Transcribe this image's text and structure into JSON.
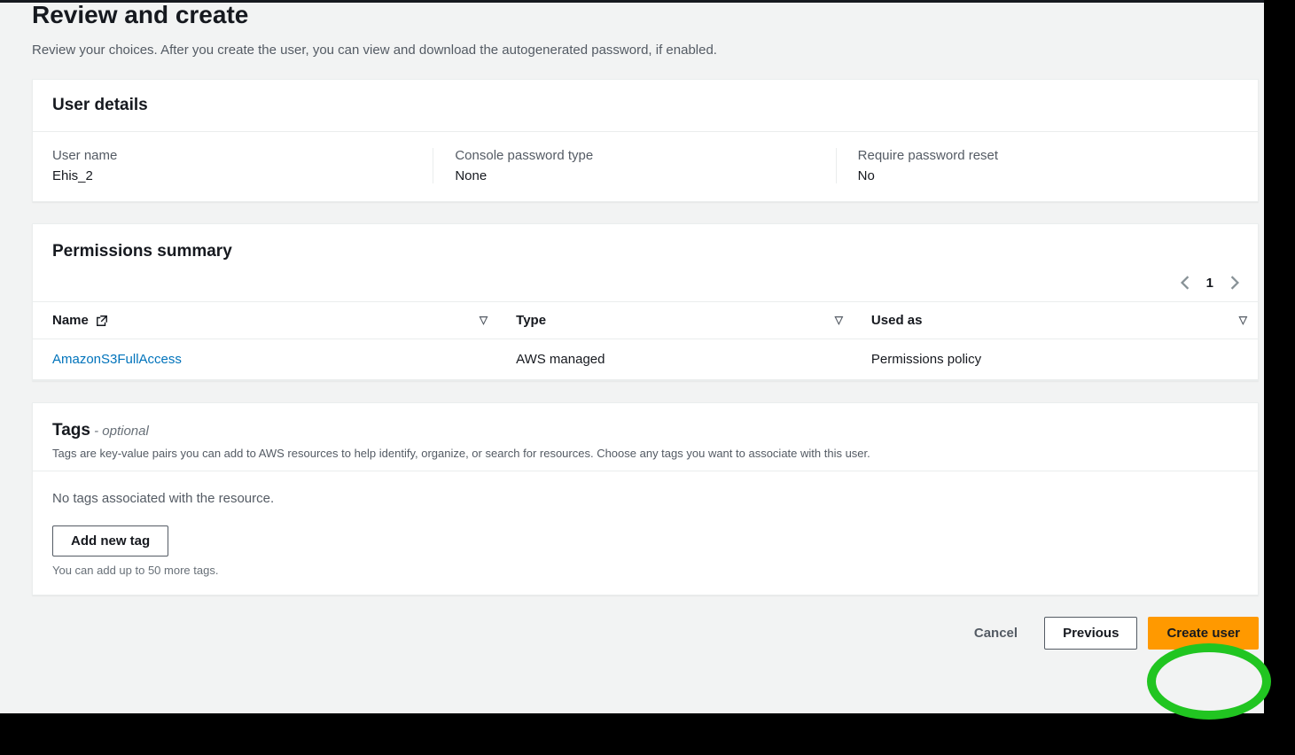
{
  "page": {
    "title": "Review and create",
    "subtitle": "Review your choices. After you create the user, you can view and download the autogenerated password, if enabled."
  },
  "userDetails": {
    "heading": "User details",
    "fields": {
      "userNameLabel": "User name",
      "userNameValue": "Ehis_2",
      "passwordTypeLabel": "Console password type",
      "passwordTypeValue": "None",
      "requireResetLabel": "Require password reset",
      "requireResetValue": "No"
    }
  },
  "permissions": {
    "heading": "Permissions summary",
    "pagination": {
      "current": "1"
    },
    "columns": {
      "name": "Name",
      "type": "Type",
      "usedAs": "Used as"
    },
    "rows": [
      {
        "name": "AmazonS3FullAccess",
        "type": "AWS managed",
        "usedAs": "Permissions policy"
      }
    ]
  },
  "tags": {
    "heading": "Tags",
    "optional": " - optional",
    "description": "Tags are key-value pairs you can add to AWS resources to help identify, organize, or search for resources. Choose any tags you want to associate with this user.",
    "emptyMsg": "No tags associated with the resource.",
    "addBtn": "Add new tag",
    "limitHint": "You can add up to 50 more tags."
  },
  "actions": {
    "cancel": "Cancel",
    "previous": "Previous",
    "create": "Create user"
  }
}
